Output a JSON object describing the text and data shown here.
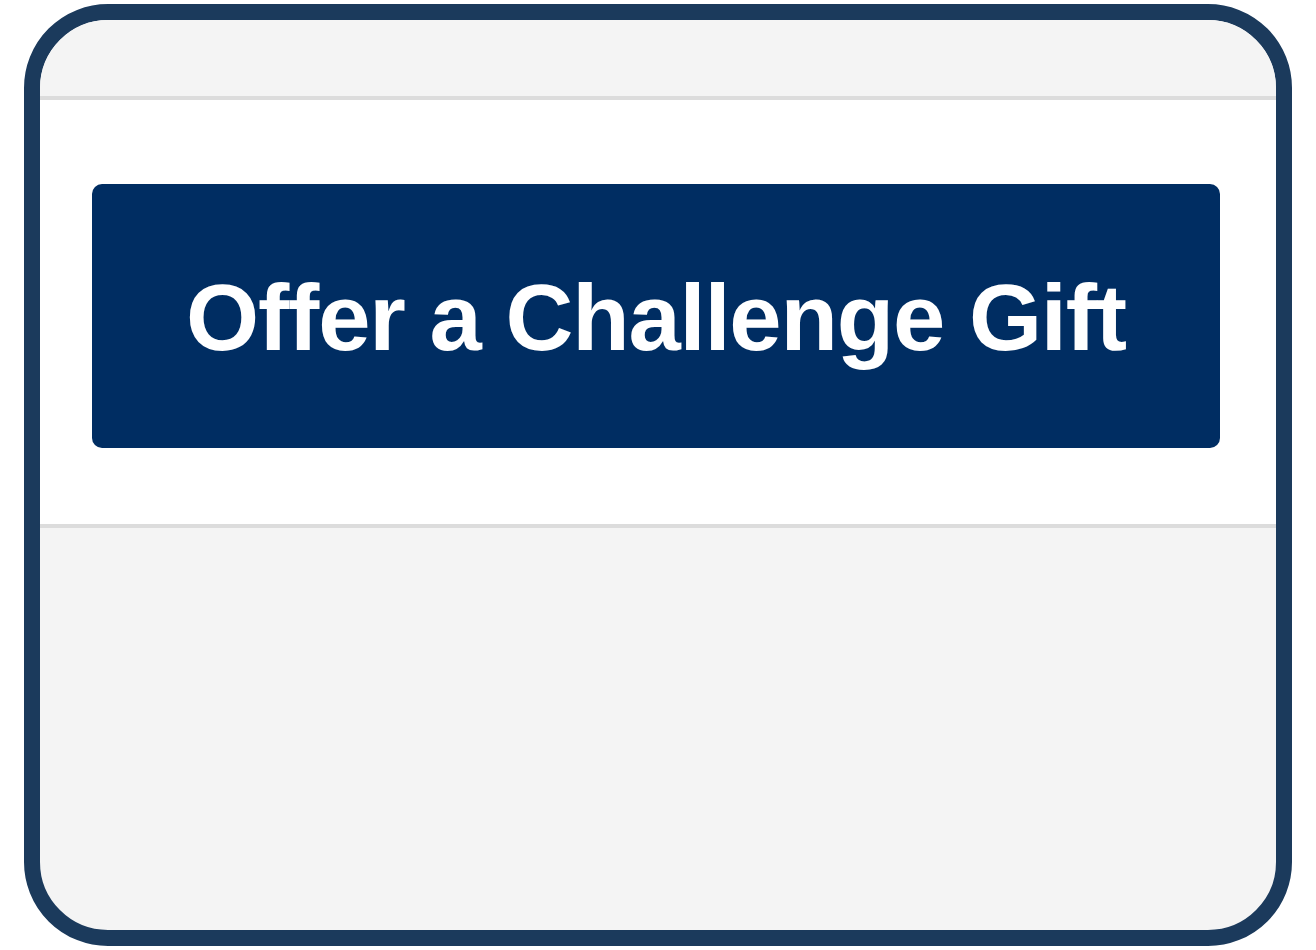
{
  "button": {
    "label": "Offer a Challenge Gift"
  }
}
